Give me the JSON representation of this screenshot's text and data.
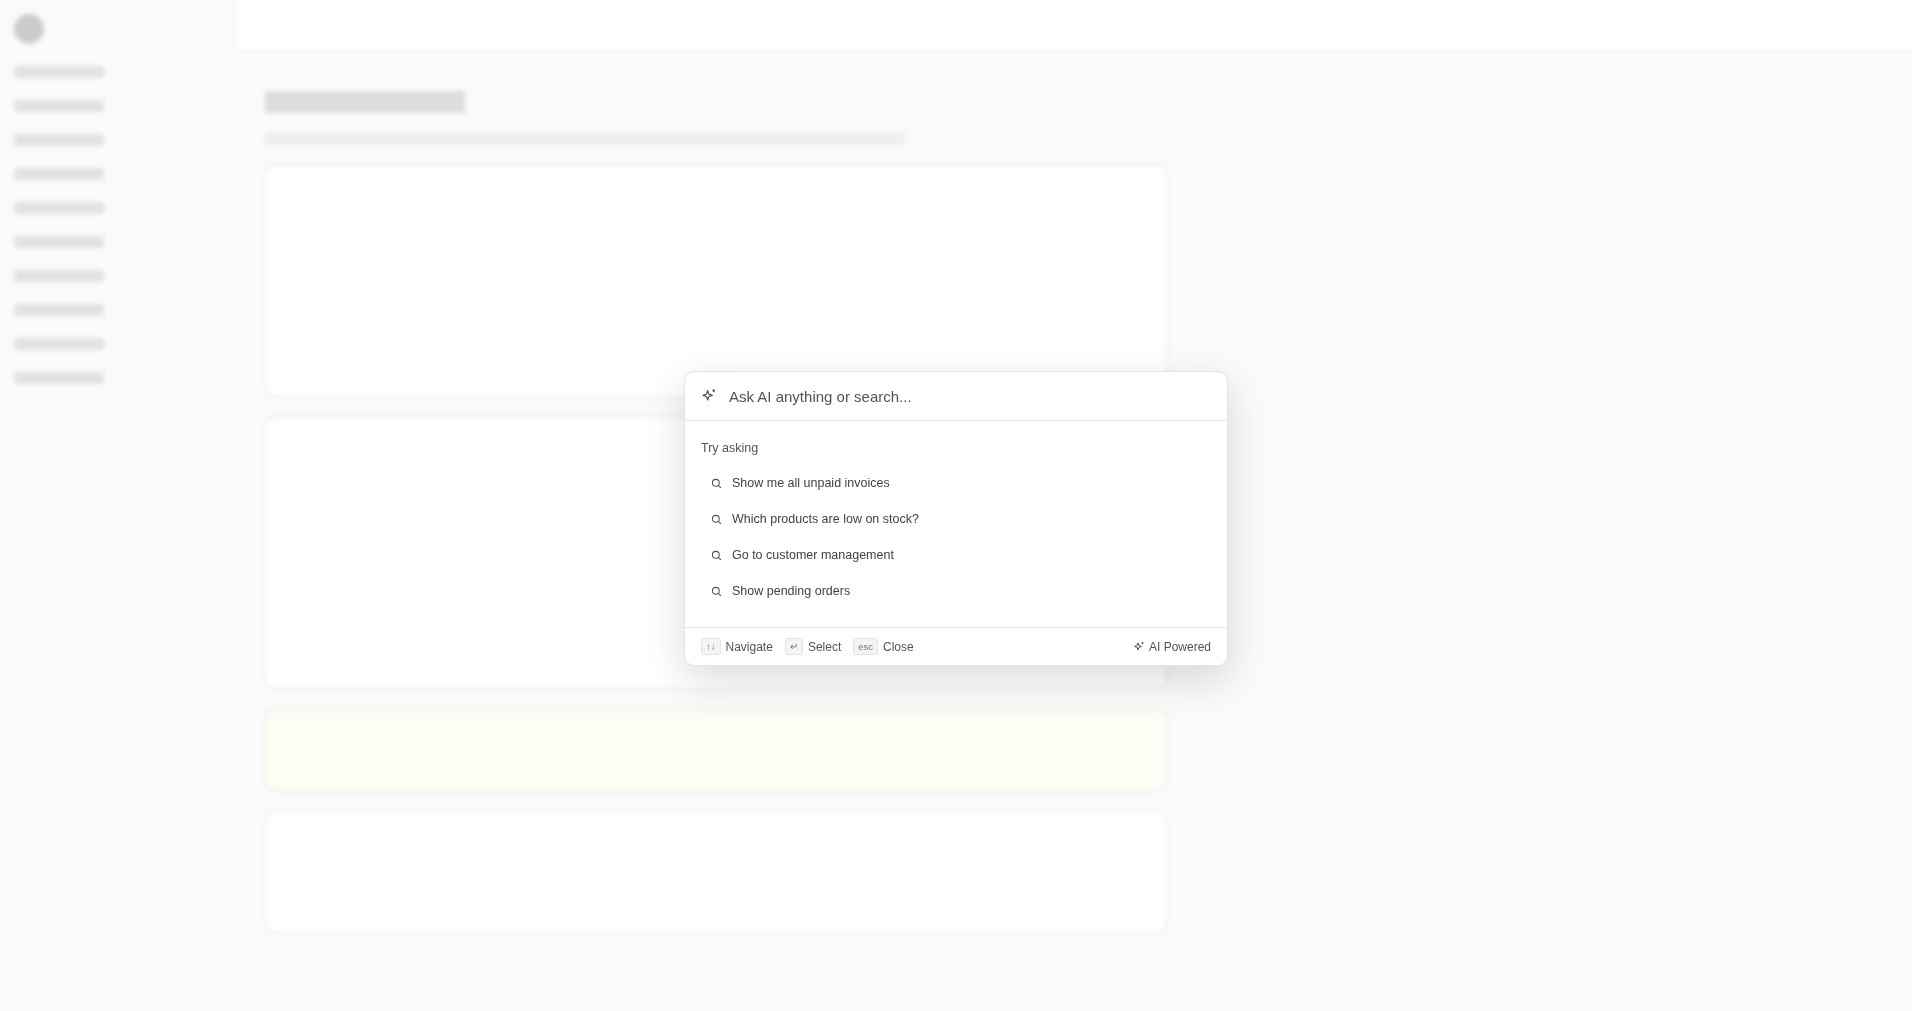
{
  "search": {
    "placeholder": "Ask AI anything or search..."
  },
  "suggestions": {
    "title": "Try asking",
    "items": [
      {
        "label": "Show me all unpaid invoices"
      },
      {
        "label": "Which products are low on stock?"
      },
      {
        "label": "Go to customer management"
      },
      {
        "label": "Show pending orders"
      }
    ]
  },
  "footer": {
    "hints": [
      {
        "key": "↑↓",
        "label": "Navigate"
      },
      {
        "key": "↵",
        "label": "Select"
      },
      {
        "key": "esc",
        "label": "Close"
      }
    ],
    "badge": "AI Powered"
  }
}
